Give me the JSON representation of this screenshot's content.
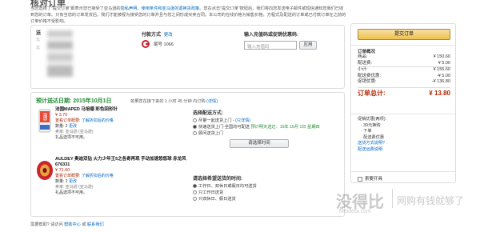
{
  "page": {
    "title": "核对订单",
    "intro_text": "当您选择了\"提交订单\"即表示您已接受了亚马逊的",
    "intro_link1": "隐私声明",
    "intro_link2": "使用条件和亚马逊的退换货政策",
    "intro_text2": "。您在点击\"提交订单\"按钮后，我们将向您发送电子邮件或短信通知您我们已收到您的订单。只有当您的订单发货后，我们才能被视为接受您的订单并且与您之间形成买卖合同。本公司的在线价格为销售价格，方程式及配送的订单或已付款订单在之前的订单价格不受影响。"
  },
  "address": {
    "label": "送",
    "change": "更改"
  },
  "payment": {
    "label": "付款方式",
    "change": "更改",
    "card_text": "尾号 1066"
  },
  "coupon": {
    "label": "输入充值码或促销优惠码:",
    "placeholder": "输入充值码",
    "apply": "应用"
  },
  "delivery": {
    "estimate_label": "预计送达日期: 2015年10月1日",
    "countdown": "如果您在接下来的 1 小时 45 分钟 内订购",
    "details": "(详情)"
  },
  "items": [
    {
      "name": "法国MAPED 马培德 彩色回形针",
      "price": "¥ 3.70",
      "note_prefix": "置看订单概要:",
      "note_link": "了解折扣后的价格",
      "qty": "数量: 2",
      "qty_change": "更改",
      "seller": "卖家: 亚马逊 (亚马逊)",
      "gift": "礼品选项不可用。"
    },
    {
      "name": "AULDEY 奥迪双钻 火力少年王5之各奇再现 手动加速悠悠球 赤龙风 676331",
      "price": "¥ 71.60",
      "note_prefix": "置看订单概要:",
      "note_link": "了解折扣后的价格",
      "qty": "数量: 2",
      "qty_change": "更改",
      "seller": "卖家: 亚马逊 (亚马逊)",
      "gift": "礼品选项不可用。"
    }
  ],
  "shipping": {
    "title": "选择配送方式:",
    "options": [
      {
        "text": "尽量一起送货上门 -",
        "link": "(只详情)",
        "selected": false
      },
      {
        "text": "快速送货上门-全国均可配送",
        "highlight": "预计明天送达：15年 10月 1日 星期四",
        "selected": true
      },
      {
        "text": "顾问送货上门",
        "selected": false
      }
    ],
    "time_button": "请选择时间"
  },
  "time_pref": {
    "title": "请选择希望送货的时间:",
    "options": [
      {
        "text": "工作日、双休日或假日均可送货",
        "selected": true
      },
      {
        "text": "只工作日送货",
        "selected": false
      },
      {
        "text": "只双休日、假日送货",
        "selected": false
      }
    ]
  },
  "summary": {
    "submit": "提交订单",
    "heading": "订单概况",
    "rows": [
      {
        "label": "商品:",
        "value": "¥ 150.60"
      },
      {
        "label": "配送费:",
        "value": "¥ 5.00"
      },
      {
        "label": "小计:",
        "value": "¥ 155.60"
      },
      {
        "label": "配送费优惠:",
        "value": "-¥ 5.00"
      },
      {
        "label": "促销优惠:",
        "value": "-¥ 136.80"
      }
    ],
    "total_label": "订单总计:",
    "total_value": "¥ 13.80",
    "promo_heading": "促销优惠(两项):",
    "promo_items": [
      "· 39元换购",
      "· 下单",
      "· 配送费优惠"
    ],
    "promo_link": "送货方式说明?",
    "promo_link2": "配送运费说明",
    "invoice": "索要开具"
  },
  "footer": {
    "text_prefix": "需要帮助? 请访问",
    "link1": "帮助中心",
    "text_mid": "或",
    "link2": "联系我们"
  },
  "watermark": {
    "brand": "没得比",
    "site": "Meidebi.com",
    "slogan": "网购有钱就够了"
  }
}
